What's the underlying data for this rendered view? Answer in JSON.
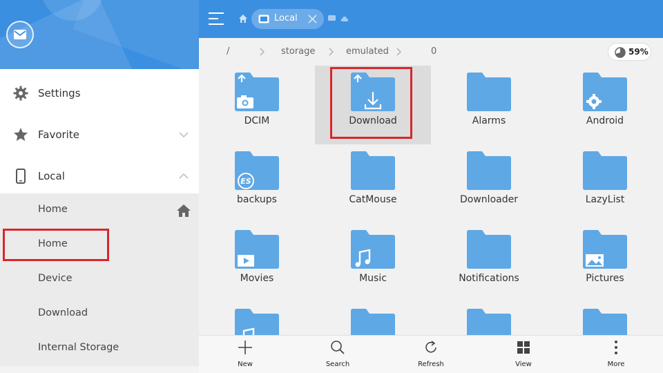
{
  "colors": {
    "accent": "#3b8fe0",
    "folder": "#5ea8e6",
    "highlight": "#d9262b"
  },
  "drawer": {
    "items": [
      {
        "label": "Settings",
        "icon": "gear-icon"
      },
      {
        "label": "Favorite",
        "icon": "star-icon"
      },
      {
        "label": "Local",
        "icon": "phone-icon"
      }
    ],
    "local_sub": [
      "Home",
      "Home",
      "Device",
      "Download",
      "Internal Storage"
    ]
  },
  "topbar": {
    "tab_label": "Local"
  },
  "path": {
    "crumbs": [
      "/",
      "storage",
      "emulated",
      "0"
    ],
    "storage_percent": "59%"
  },
  "folders": [
    {
      "name": "DCIM",
      "badge": "camera"
    },
    {
      "name": "Download",
      "badge": "download",
      "selected": true
    },
    {
      "name": "Alarms",
      "badge": ""
    },
    {
      "name": "Android",
      "badge": "gear"
    },
    {
      "name": "backups",
      "badge": "es"
    },
    {
      "name": "CatMouse",
      "badge": ""
    },
    {
      "name": "Downloader",
      "badge": ""
    },
    {
      "name": "LazyList",
      "badge": ""
    },
    {
      "name": "Movies",
      "badge": "video"
    },
    {
      "name": "Music",
      "badge": "music"
    },
    {
      "name": "Notifications",
      "badge": ""
    },
    {
      "name": "Pictures",
      "badge": "image"
    },
    {
      "name": "",
      "badge": "music"
    },
    {
      "name": "",
      "badge": ""
    },
    {
      "name": "",
      "badge": ""
    },
    {
      "name": "",
      "badge": ""
    }
  ],
  "toolbar": {
    "new": "New",
    "search": "Search",
    "refresh": "Refresh",
    "view": "View",
    "more": "More"
  }
}
